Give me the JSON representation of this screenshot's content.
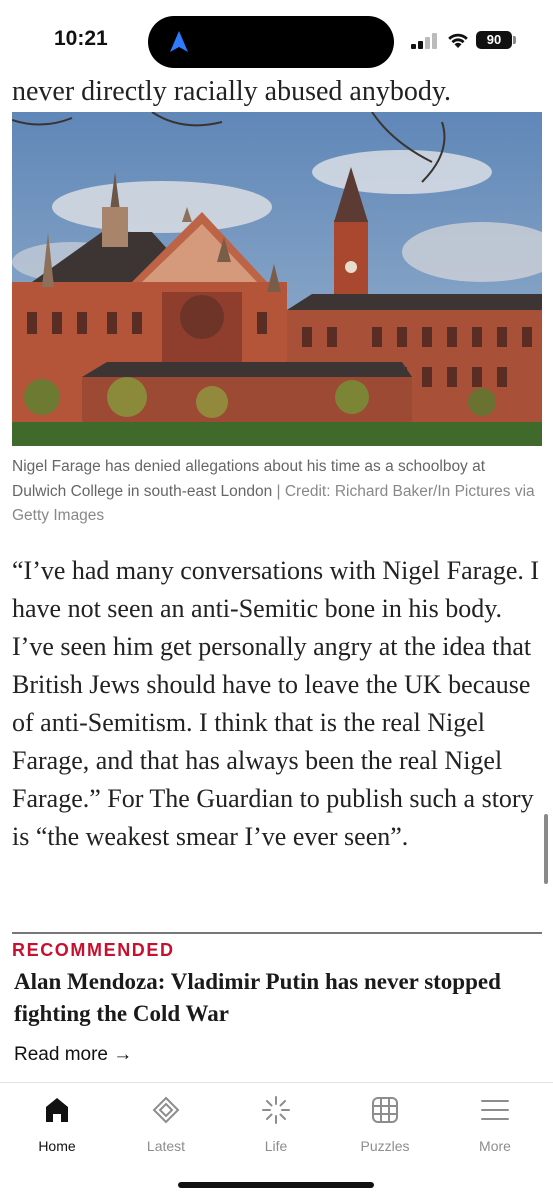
{
  "status_bar": {
    "time": "10:21",
    "battery": "90",
    "icons": [
      "location-arrow-icon",
      "cellular-signal-icon",
      "wifi-icon",
      "battery-icon"
    ]
  },
  "article": {
    "lead_line": "never directly racially abused anybody.",
    "image_alt": "Dulwich College building",
    "caption": "Nigel Farage has denied allegations about his time as a schoolboy at Dulwich College in south-east London",
    "credit": "Credit: Richard Baker/In Pictures via Getty Images",
    "quote": "“I’ve had many conversations with Nigel Farage. I have not seen an anti-Semitic bone in his body. I’ve seen him get personally angry at the idea that British Jews should have to leave the UK because of anti-Semitism. I think that is the real Nigel Farage, and that has always been the real Nigel Farage.” For The Guardian to publish such a story is “the weakest smear I’ve ever seen”."
  },
  "recommended": {
    "label": "RECOMMENDED",
    "title": "Alan Mendoza: Vladimir Putin has never stopped fighting the Cold War",
    "read_more": "Read more →"
  },
  "tab_bar": {
    "tabs": [
      {
        "label": "Home",
        "icon": "home-icon",
        "active": true
      },
      {
        "label": "Latest",
        "icon": "latest-icon",
        "active": false
      },
      {
        "label": "Life",
        "icon": "life-icon",
        "active": false
      },
      {
        "label": "Puzzles",
        "icon": "puzzles-icon",
        "active": false
      },
      {
        "label": "More",
        "icon": "menu-icon",
        "active": false
      }
    ]
  },
  "colors": {
    "accent_red": "#c8102e",
    "text": "#222222",
    "caption": "#666666",
    "tab_inactive": "#8d8d8d"
  }
}
